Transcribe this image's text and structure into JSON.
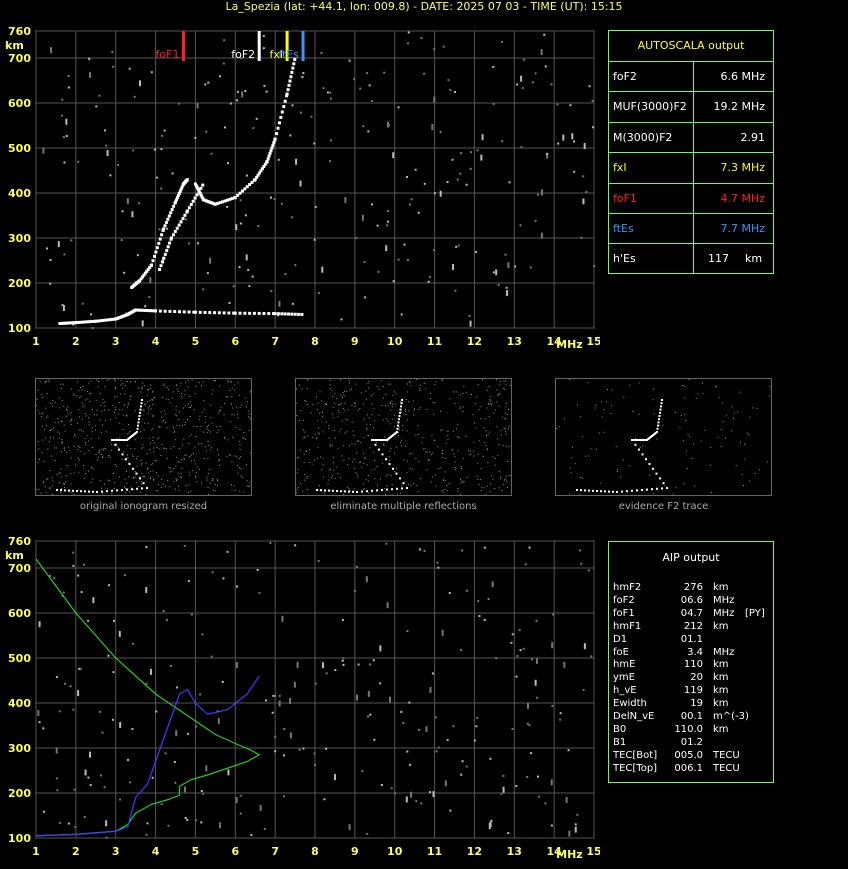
{
  "header": {
    "title": "La_Spezia (lat: +44.1, lon: 009.8) - DATE: 2025 07 03 - TIME (UT): 15:15"
  },
  "autoscala": {
    "title": "AUTOSCALA output",
    "rows": [
      {
        "label": "foF2",
        "value": "6.6 MHz",
        "color": "#ffffff"
      },
      {
        "label": "MUF(3000)F2",
        "value": "19.2 MHz",
        "color": "#ffffff"
      },
      {
        "label": "M(3000)F2",
        "value": "2.91",
        "color": "#ffffff"
      },
      {
        "label": "fxI",
        "value": "7.3 MHz",
        "color": "#ffff00"
      },
      {
        "label": "foF1",
        "value": "4.7 MHz",
        "color": "#ff2020"
      },
      {
        "label": "ftEs",
        "value": "7.7 MHz",
        "color": "#3399ff"
      },
      {
        "label": "h'Es",
        "value": "117",
        "unit": "km",
        "color": "#ffffff"
      }
    ]
  },
  "thumbnails": {
    "captions": [
      "original ionogram resized",
      "eliminate multiple reflections",
      "evidence F2 trace"
    ]
  },
  "aip": {
    "title": "AIP output",
    "rows": [
      {
        "name": "hmF2",
        "value": "276",
        "unit": "km",
        "extra": ""
      },
      {
        "name": "foF2",
        "value": "06.6",
        "unit": "MHz",
        "extra": ""
      },
      {
        "name": "foF1",
        "value": "04.7",
        "unit": "MHz",
        "extra": "[PY]"
      },
      {
        "name": "hmF1",
        "value": "212",
        "unit": "km",
        "extra": ""
      },
      {
        "name": "D1",
        "value": "01.1",
        "unit": "",
        "extra": ""
      },
      {
        "name": "foE",
        "value": "3.4",
        "unit": "MHz",
        "extra": ""
      },
      {
        "name": "hmE",
        "value": "110",
        "unit": "km",
        "extra": ""
      },
      {
        "name": "ymE",
        "value": "20",
        "unit": "km",
        "extra": ""
      },
      {
        "name": "h_vE",
        "value": "119",
        "unit": "km",
        "extra": ""
      },
      {
        "name": "Ewidth",
        "value": "19",
        "unit": "km",
        "extra": ""
      },
      {
        "name": "DelN_vE",
        "value": "00.1",
        "unit": "m^(-3)",
        "extra": ""
      },
      {
        "name": "B0",
        "value": "110.0",
        "unit": "km",
        "extra": ""
      },
      {
        "name": "B1",
        "value": "01.2",
        "unit": "",
        "extra": ""
      },
      {
        "name": "TEC[Bot]",
        "value": "005.0",
        "unit": "TECU",
        "extra": ""
      },
      {
        "name": "TEC[Top]",
        "value": "006.1",
        "unit": "TECU",
        "extra": ""
      }
    ]
  },
  "chart_data": [
    {
      "type": "scatter",
      "name": "ionogram-top",
      "xlabel": "MHz",
      "ylabel": "km",
      "xlim": [
        1,
        15
      ],
      "ylim": [
        100,
        760
      ],
      "xticks": [
        1,
        2,
        3,
        4,
        5,
        6,
        7,
        8,
        9,
        10,
        11,
        12,
        13,
        14,
        15
      ],
      "yticks": [
        100,
        200,
        300,
        400,
        500,
        600,
        700,
        760
      ],
      "grid": true,
      "markers": [
        {
          "label": "foF1",
          "x": 4.7,
          "color": "#ff2020"
        },
        {
          "label": "foF2",
          "x": 6.6,
          "color": "#ffffff"
        },
        {
          "label": "fxI",
          "x": 7.3,
          "color": "#ffff00"
        },
        {
          "label": "ftEs",
          "x": 7.7,
          "color": "#3399ff"
        }
      ],
      "series": [
        {
          "values": [
            [
              1.6,
              110
            ],
            [
              2.0,
              112
            ],
            [
              2.5,
              115
            ],
            [
              3.0,
              120
            ],
            [
              3.3,
              130
            ],
            [
              3.5,
              140
            ],
            [
              4.0,
              138
            ],
            [
              5.0,
              135
            ],
            [
              6.0,
              133
            ],
            [
              7.0,
              132
            ],
            [
              7.7,
              130
            ]
          ]
        },
        {
          "values": [
            [
              3.4,
              190
            ],
            [
              3.6,
              205
            ],
            [
              3.9,
              240
            ],
            [
              4.2,
              320
            ],
            [
              4.5,
              380
            ],
            [
              4.7,
              420
            ],
            [
              4.8,
              430
            ]
          ]
        },
        {
          "values": [
            [
              5.0,
              420
            ],
            [
              5.2,
              385
            ],
            [
              5.5,
              375
            ],
            [
              6.0,
              390
            ],
            [
              6.5,
              430
            ],
            [
              6.8,
              470
            ],
            [
              7.0,
              520
            ],
            [
              7.3,
              620
            ],
            [
              7.5,
              700
            ]
          ]
        },
        {
          "values": [
            [
              4.1,
              230
            ],
            [
              4.4,
              300
            ],
            [
              4.8,
              360
            ],
            [
              5.2,
              420
            ]
          ]
        }
      ]
    },
    {
      "type": "line",
      "name": "ionogram-aip",
      "xlabel": "MHz",
      "ylabel": "km",
      "xlim": [
        1,
        15
      ],
      "ylim": [
        100,
        760
      ],
      "xticks": [
        1,
        2,
        3,
        4,
        5,
        6,
        7,
        8,
        9,
        10,
        11,
        12,
        13,
        14,
        15
      ],
      "yticks": [
        100,
        200,
        300,
        400,
        500,
        600,
        700,
        760
      ],
      "grid": true,
      "series": [
        {
          "color": "#22cc22",
          "values": [
            [
              1.0,
              720
            ],
            [
              1.5,
              660
            ],
            [
              2.0,
              600
            ],
            [
              2.5,
              550
            ],
            [
              3.0,
              500
            ],
            [
              3.5,
              460
            ],
            [
              4.0,
              420
            ],
            [
              4.5,
              390
            ],
            [
              5.0,
              360
            ],
            [
              5.5,
              330
            ],
            [
              6.0,
              310
            ],
            [
              6.4,
              295
            ],
            [
              6.6,
              285
            ],
            [
              6.3,
              270
            ],
            [
              5.8,
              255
            ],
            [
              5.3,
              240
            ],
            [
              4.9,
              230
            ],
            [
              4.6,
              215
            ],
            [
              4.6,
              195
            ],
            [
              4.3,
              185
            ],
            [
              3.9,
              175
            ],
            [
              3.5,
              155
            ],
            [
              3.3,
              130
            ],
            [
              3.0,
              115
            ],
            [
              2.0,
              108
            ],
            [
              1.0,
              105
            ]
          ]
        },
        {
          "color": "#3344ff",
          "values": [
            [
              1.0,
              105
            ],
            [
              2.0,
              108
            ],
            [
              3.0,
              115
            ],
            [
              3.3,
              125
            ],
            [
              3.5,
              190
            ],
            [
              3.8,
              220
            ],
            [
              4.2,
              320
            ],
            [
              4.6,
              420
            ],
            [
              4.8,
              430
            ],
            [
              5.0,
              400
            ],
            [
              5.3,
              375
            ],
            [
              5.8,
              385
            ],
            [
              6.3,
              420
            ],
            [
              6.6,
              460
            ]
          ]
        }
      ]
    }
  ]
}
